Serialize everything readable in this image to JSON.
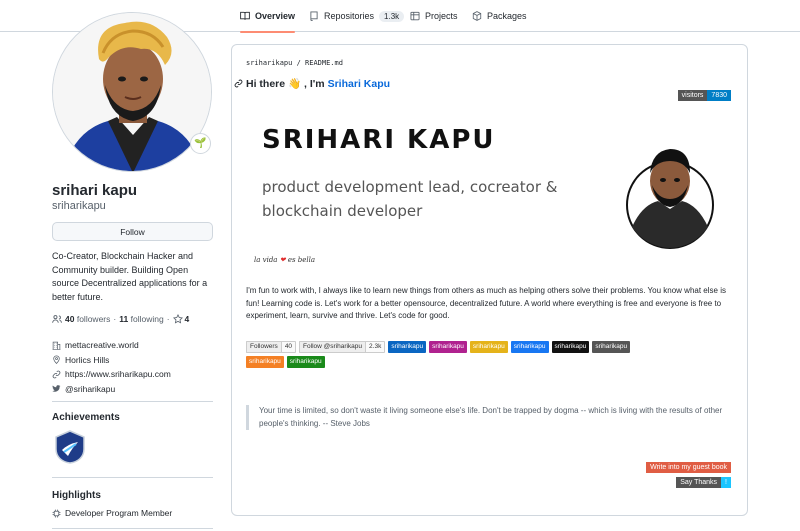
{
  "nav": {
    "tabs": [
      {
        "label": "Overview",
        "icon": "book-icon"
      },
      {
        "label": "Repositories",
        "icon": "repo-icon",
        "count": "1.3k"
      },
      {
        "label": "Projects",
        "icon": "table-icon"
      },
      {
        "label": "Packages",
        "icon": "package-icon"
      }
    ]
  },
  "profile": {
    "full_name": "srihari kapu",
    "login": "sriharikapu",
    "follow_label": "Follow",
    "bio": "Co-Creator, Blockchain Hacker and Community builder. Building Open source Decentralized applications for a better future.",
    "followers_count": "40",
    "followers_label": "followers",
    "dot": "·",
    "following_count": "11",
    "following_label": "following",
    "stars_count": "4",
    "company": "mettacreative.world",
    "location": "Horlics Hills",
    "website": "https://www.sriharikapu.com",
    "twitter": "@sriharikapu",
    "achievements_title": "Achievements",
    "highlights_title": "Highlights",
    "highlight_item": "Developer Program Member"
  },
  "readme": {
    "path_user": "sriharikapu",
    "path_sep": " / ",
    "path_file": "README.md",
    "greeting_prefix": "Hi there 👋 , I'm",
    "greeting_name": "Srihari Kapu",
    "visitors_label": "visitors",
    "visitors_count": "7830",
    "banner_name": "SRIHARI KAPU",
    "banner_tagline_1": "product development lead, cocreator &",
    "banner_tagline_2": "blockchain developer",
    "signature_1": "la vida",
    "signature_heart": "❤",
    "signature_2": "es bella",
    "intro": "I'm fun to work with, I always like to learn new things from others as much as helping others solve their problems. You know what else is fun! Learning code is. Let's work for a better opensource, decentralized future. A world where everything is free and everyone is free to experiment, learn, survive and thrive. Let's code for good.",
    "badges_row1": [
      {
        "type": "gh",
        "label": "Followers",
        "value": "40"
      },
      {
        "type": "gh",
        "label": "Follow @sriharikapu",
        "value": "2.3k"
      },
      {
        "label": "sriharikapu",
        "color": "#0a66c2"
      },
      {
        "label": "sriharikapu",
        "color": "#b0228f"
      },
      {
        "label": "sriharikapu",
        "color": "#e5b31a"
      },
      {
        "label": "sriharikapu",
        "color": "#1877f2"
      },
      {
        "label": "sriharikapu",
        "color": "#111111"
      },
      {
        "label": "sriharikapu",
        "color": "#555555"
      }
    ],
    "badges_row2": [
      {
        "label": "sriharikapu",
        "color": "#f48024"
      },
      {
        "label": "sriharikapu",
        "color": "#1a8a1a"
      }
    ],
    "quote": "Your time is limited, so don't waste it living someone else's life. Don't be trapped by dogma -- which is living with the results of other people's thinking. -- Steve Jobs",
    "guestbook_label": "Write into my guest book",
    "thanks_label": "Say Thanks",
    "thanks_value": "!"
  },
  "colors": {
    "accent_link": "#0969da",
    "tab_underline": "#fd8c73",
    "visitors_left": "#555555",
    "visitors_right": "#007ec6",
    "guestbook": "#e05d44",
    "thanks_right": "#1bc5ff"
  }
}
